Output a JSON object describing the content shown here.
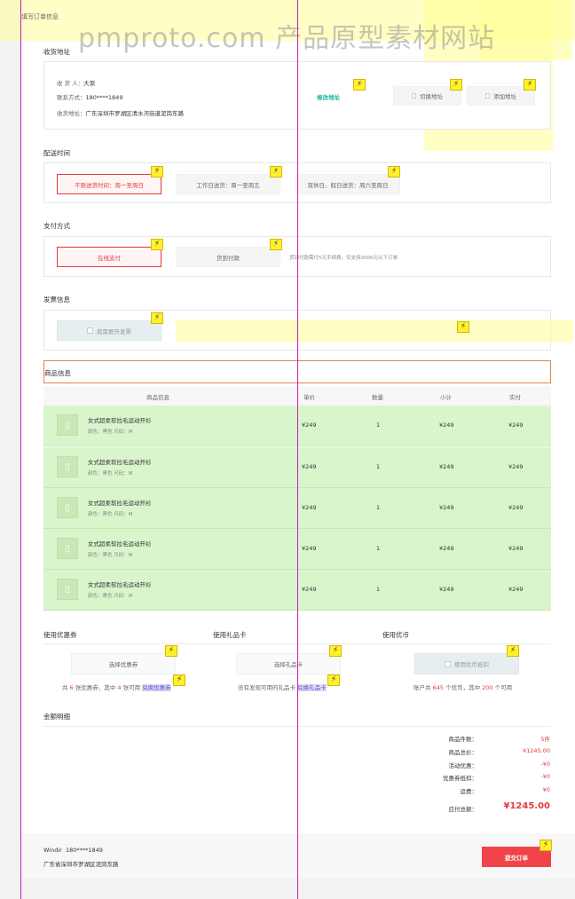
{
  "page_title": "填写订单信息",
  "watermark": "pmproto.com 产品原型素材网站",
  "address": {
    "section_title": "收货地址",
    "receiver_label": "收 货 人：",
    "receiver_name": "大渐",
    "phone_label": "联系方式：",
    "phone": "180****1849",
    "addr_label": "收货地址：",
    "addr": "广东深圳市罗湖区清水河街道泥岗东路",
    "edit_label": "修改地址",
    "switch_label": "切换地址",
    "add_label": "添加地址"
  },
  "delivery": {
    "section_title": "配送时间",
    "options": [
      {
        "label": "不限送货时间：周一至周日",
        "selected": true
      },
      {
        "label": "工作日送货：周一至周五",
        "selected": false
      },
      {
        "label": "双休日、假日送货：周六至周日",
        "selected": false
      }
    ]
  },
  "payment": {
    "section_title": "支付方式",
    "options": [
      {
        "label": "在线支付",
        "selected": true
      },
      {
        "label": "货到付款",
        "selected": false
      }
    ],
    "note": "货到付款需付5元手续费，仅支持2000元以下订单"
  },
  "invoice": {
    "section_title": "发票信息",
    "checkbox_label": "我需要开发票"
  },
  "goods": {
    "section_title": "商品信息",
    "headers": [
      "商品信息",
      "单价",
      "数量",
      "小计",
      "实付"
    ],
    "rows": [
      {
        "name": "女式超柔软拉毛运动开衫",
        "spec": "颜色：黑色 尺码：M",
        "price": "¥249",
        "qty": "1",
        "subtotal": "¥249",
        "paid": "¥249"
      },
      {
        "name": "女式超柔软拉毛运动开衫",
        "spec": "颜色：黑色 尺码：M",
        "price": "¥249",
        "qty": "1",
        "subtotal": "¥249",
        "paid": "¥249"
      },
      {
        "name": "女式超柔软拉毛运动开衫",
        "spec": "颜色：黑色 尺码：M",
        "price": "¥249",
        "qty": "1",
        "subtotal": "¥249",
        "paid": "¥249"
      },
      {
        "name": "女式超柔软拉毛运动开衫",
        "spec": "颜色：黑色 尺码：M",
        "price": "¥249",
        "qty": "1",
        "subtotal": "¥249",
        "paid": "¥249"
      },
      {
        "name": "女式超柔软拉毛运动开衫",
        "spec": "颜色：黑色 尺码：M",
        "price": "¥249",
        "qty": "1",
        "subtotal": "¥249",
        "paid": "¥249"
      }
    ]
  },
  "coupon": {
    "title": "使用优惠券",
    "button": "选择优惠券",
    "info_a": "共 ",
    "info_count": "6",
    "info_b": " 张优惠券，其中 ",
    "info_usable": "4",
    "info_c": " 张可用 ",
    "link": "兑换优惠券"
  },
  "giftcard": {
    "title": "使用礼品卡",
    "button": "选择礼品卡",
    "info": "没有发现可用的礼品卡 ",
    "link": "兑换礼品卡"
  },
  "coins": {
    "title": "使用优币",
    "checkbox_label": "使用优币抵扣",
    "info_a": "账户共 ",
    "info_total": "645",
    "info_b": " 个优币，其中 ",
    "info_usable": "200",
    "info_c": " 个可用"
  },
  "summary": {
    "section_title": "金额明细",
    "items": [
      {
        "label": "商品件数：",
        "value": "5件"
      },
      {
        "label": "商品总价：",
        "value": "¥1245.00"
      },
      {
        "label": "活动优惠：",
        "value": "-¥0"
      },
      {
        "label": "优惠券抵扣：",
        "value": "-¥0"
      },
      {
        "label": "运费：",
        "value": "¥0"
      }
    ],
    "total_label": "应付总额：",
    "total_value": "¥1245.00"
  },
  "footer": {
    "receiver": "Windir",
    "phone": "180****1849",
    "address": "广东省深圳市罗湖区泥岗东路",
    "submit_label": "提交订单"
  },
  "flash_icon_glyph": "⚡",
  "colors": {
    "accent_red": "#e4393c",
    "edit_green": "#14b8a0",
    "goods_bg": "#d9f5cc",
    "highlight_yellow": "#ffff96"
  }
}
